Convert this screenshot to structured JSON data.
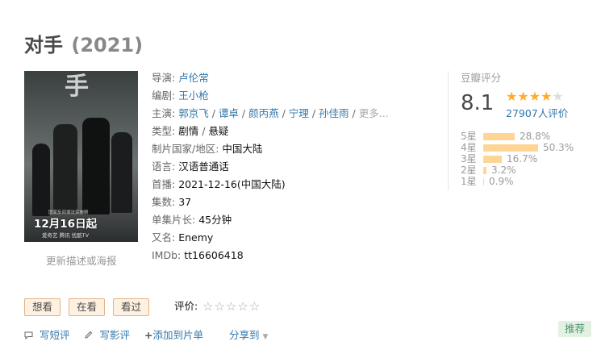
{
  "title": {
    "main": "对手",
    "year": "(2021)"
  },
  "poster": {
    "date_text": "12月16日起",
    "tagline": "国家反间谍法实施剧",
    "brands": "爱奇艺  腾讯  优酷TV",
    "logo_char": "手"
  },
  "update_link": "更新描述或海报",
  "info": {
    "director": {
      "label": "导演:",
      "names": [
        "卢伦常"
      ]
    },
    "writer": {
      "label": "编剧:",
      "names": [
        "王小枪"
      ]
    },
    "cast": {
      "label": "主演:",
      "names": [
        "郭京飞",
        "谭卓",
        "颜丙燕",
        "宁理",
        "孙佳雨"
      ],
      "more": "更多..."
    },
    "genre": {
      "label": "类型:",
      "values": [
        "剧情",
        "悬疑"
      ]
    },
    "region": {
      "label": "制片国家/地区:",
      "value": "中国大陆"
    },
    "language": {
      "label": "语言:",
      "value": "汉语普通话"
    },
    "premiere": {
      "label": "首播:",
      "value": "2021-12-16(中国大陆)"
    },
    "episodes": {
      "label": "集数:",
      "value": "37"
    },
    "runtime": {
      "label": "单集片长:",
      "value": "45分钟"
    },
    "aka": {
      "label": "又名:",
      "value": "Enemy"
    },
    "imdb": {
      "label": "IMDb:",
      "value": "tt16606418"
    }
  },
  "rating": {
    "label": "豆瓣评分",
    "score": "8.1",
    "stars_filled": 4,
    "stars_total": 5,
    "people": "27907人评价",
    "distribution": [
      {
        "label": "5星",
        "percent": "28.8%",
        "value": 28.8
      },
      {
        "label": "4星",
        "percent": "50.3%",
        "value": 50.3
      },
      {
        "label": "3星",
        "percent": "16.7%",
        "value": 16.7
      },
      {
        "label": "2星",
        "percent": "3.2%",
        "value": 3.2
      },
      {
        "label": "1星",
        "percent": "0.9%",
        "value": 0.9
      }
    ]
  },
  "actions": {
    "want": "想看",
    "watching": "在看",
    "watched": "看过",
    "rate_label": "评价:",
    "rate_stars": "☆☆☆☆☆"
  },
  "ops": {
    "short_review": "写短评",
    "review": "写影评",
    "add_list": "添加到片单",
    "add_prefix": "+",
    "share": "分享到"
  },
  "recommend": "推荐",
  "colors": {
    "link": "#3377aa",
    "star": "#ffac2d",
    "bar": "#ffd596",
    "btn_bg": "#fff1e1",
    "btn_border": "#e3b285"
  }
}
